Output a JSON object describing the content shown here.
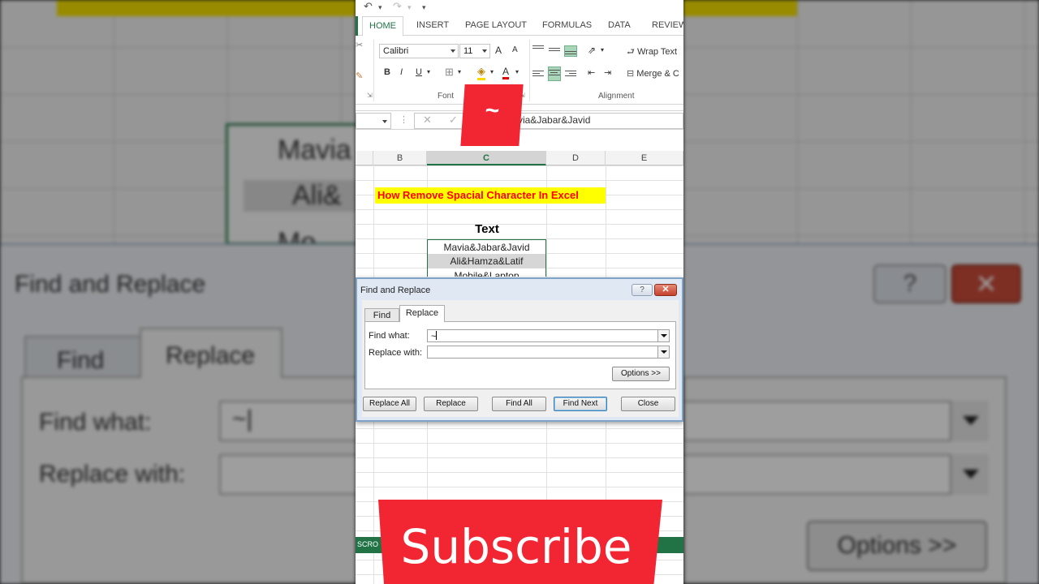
{
  "qat": {
    "undo": "↶",
    "redo": "↷",
    "more": "▾"
  },
  "ribbon_tabs": [
    "HOME",
    "INSERT",
    "PAGE LAYOUT",
    "FORMULAS",
    "DATA",
    "REVIEW"
  ],
  "ribbon": {
    "font_name": "Calibri",
    "font_size": "11",
    "grow_font": "A",
    "shrink_font": "A",
    "bold": "B",
    "italic": "I",
    "underline": "U",
    "font_group": "Font",
    "alignment_group": "Alignment",
    "wrap_text": "Wrap Text",
    "merge_center": "Merge & C"
  },
  "formula_bar": {
    "cancel": "✕",
    "enter": "✓",
    "content": "via&Jabar&Javid"
  },
  "columns": [
    "B",
    "C",
    "D",
    "E"
  ],
  "sheet": {
    "title": "How Remove Spacial Character In Excel",
    "header": "Text",
    "rows": [
      "Mavia&Jabar&Javid",
      "Ali&Hamza&Latif",
      "Mobile&Laptop"
    ]
  },
  "dialog": {
    "title": "Find and Replace",
    "help": "?",
    "close": "✕",
    "tab_find": "Find",
    "tab_replace": "Replace",
    "find_label": "Find what:",
    "find_value": "~",
    "replace_label": "Replace with:",
    "replace_value": "",
    "options": "Options >>",
    "replace_all": "Replace All",
    "replace": "Replace",
    "find_all": "Find All",
    "find_next": "Find Next",
    "close_button": "Close"
  },
  "status_bar": {
    "label": "SCRO"
  },
  "overlay": {
    "tilde": "~",
    "subscribe": "Subscribe"
  },
  "background": {
    "cell_row1": "Mavia",
    "cell_row2": "Ali&",
    "cell_row3": "Mo",
    "dialog_title": "Find and Replace",
    "tab_find": "Find",
    "tab_replace": "Replace",
    "find_label": "Find what:",
    "find_value": "~",
    "replace_label": "Replace with:",
    "help": "?",
    "close": "✕",
    "options": "Options >>"
  },
  "colors": {
    "excel_green": "#217346",
    "title_yellow": "#ffff00",
    "title_red": "#ff0000",
    "overlay_red": "#f22633"
  }
}
